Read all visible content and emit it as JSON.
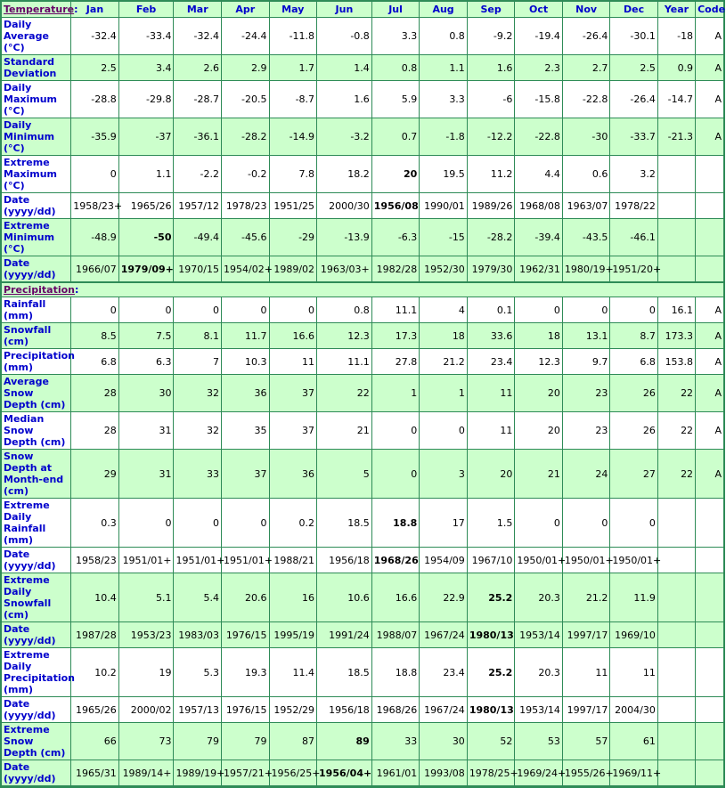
{
  "header": {
    "section1": "Temperature",
    "section2": "Precipitation",
    "colon": ":",
    "months": [
      "Jan",
      "Feb",
      "Mar",
      "Apr",
      "May",
      "Jun",
      "Jul",
      "Aug",
      "Sep",
      "Oct",
      "Nov",
      "Dec"
    ],
    "year": "Year",
    "code": "Code"
  },
  "colors": {
    "border": "#2e8b57",
    "green_row": "#ccffcc",
    "label_text": "#0000cc",
    "section_link": "#660066"
  },
  "temperature": [
    {
      "label": "Daily Average (°C)",
      "bg": "w",
      "values": [
        "-32.4",
        "-33.4",
        "-32.4",
        "-24.4",
        "-11.8",
        "-0.8",
        "3.3",
        "0.8",
        "-9.2",
        "-19.4",
        "-26.4",
        "-30.1"
      ],
      "year": "-18",
      "code": "A",
      "bold": []
    },
    {
      "label": "Standard Deviation",
      "bg": "g",
      "values": [
        "2.5",
        "3.4",
        "2.6",
        "2.9",
        "1.7",
        "1.4",
        "0.8",
        "1.1",
        "1.6",
        "2.3",
        "2.7",
        "2.5"
      ],
      "year": "0.9",
      "code": "A",
      "bold": []
    },
    {
      "label": "Daily Maximum (°C)",
      "bg": "w",
      "values": [
        "-28.8",
        "-29.8",
        "-28.7",
        "-20.5",
        "-8.7",
        "1.6",
        "5.9",
        "3.3",
        "-6",
        "-15.8",
        "-22.8",
        "-26.4"
      ],
      "year": "-14.7",
      "code": "A",
      "bold": []
    },
    {
      "label": "Daily Minimum (°C)",
      "bg": "g",
      "values": [
        "-35.9",
        "-37",
        "-36.1",
        "-28.2",
        "-14.9",
        "-3.2",
        "0.7",
        "-1.8",
        "-12.2",
        "-22.8",
        "-30",
        "-33.7"
      ],
      "year": "-21.3",
      "code": "A",
      "bold": []
    },
    {
      "label": "Extreme Maximum (°C)",
      "bg": "w",
      "values": [
        "0",
        "1.1",
        "-2.2",
        "-0.2",
        "7.8",
        "18.2",
        "20",
        "19.5",
        "11.2",
        "4.4",
        "0.6",
        "3.2"
      ],
      "year": "",
      "code": "",
      "bold": [
        6
      ]
    },
    {
      "label": "Date (yyyy/dd)",
      "bg": "w",
      "values": [
        "1958/23+",
        "1965/26",
        "1957/12",
        "1978/23",
        "1951/25",
        "2000/30",
        "1956/08",
        "1990/01",
        "1989/26",
        "1968/08",
        "1963/07",
        "1978/22"
      ],
      "year": "",
      "code": "",
      "bold": [
        6
      ]
    },
    {
      "label": "Extreme Minimum (°C)",
      "bg": "g",
      "values": [
        "-48.9",
        "-50",
        "-49.4",
        "-45.6",
        "-29",
        "-13.9",
        "-6.3",
        "-15",
        "-28.2",
        "-39.4",
        "-43.5",
        "-46.1"
      ],
      "year": "",
      "code": "",
      "bold": [
        1
      ]
    },
    {
      "label": "Date (yyyy/dd)",
      "bg": "g",
      "values": [
        "1966/07",
        "1979/09+",
        "1970/15",
        "1954/02+",
        "1989/02",
        "1963/03+",
        "1982/28",
        "1952/30",
        "1979/30",
        "1962/31",
        "1980/19+",
        "1951/20+"
      ],
      "year": "",
      "code": "",
      "bold": [
        1
      ]
    }
  ],
  "precipitation": [
    {
      "label": "Rainfall (mm)",
      "bg": "w",
      "values": [
        "0",
        "0",
        "0",
        "0",
        "0",
        "0.8",
        "11.1",
        "4",
        "0.1",
        "0",
        "0",
        "0"
      ],
      "year": "16.1",
      "code": "A",
      "bold": []
    },
    {
      "label": "Snowfall (cm)",
      "bg": "g",
      "values": [
        "8.5",
        "7.5",
        "8.1",
        "11.7",
        "16.6",
        "12.3",
        "17.3",
        "18",
        "33.6",
        "18",
        "13.1",
        "8.7"
      ],
      "year": "173.3",
      "code": "A",
      "bold": []
    },
    {
      "label": "Precipitation (mm)",
      "bg": "w",
      "values": [
        "6.8",
        "6.3",
        "7",
        "10.3",
        "11",
        "11.1",
        "27.8",
        "21.2",
        "23.4",
        "12.3",
        "9.7",
        "6.8"
      ],
      "year": "153.8",
      "code": "A",
      "bold": []
    },
    {
      "label": "Average Snow Depth (cm)",
      "bg": "g",
      "values": [
        "28",
        "30",
        "32",
        "36",
        "37",
        "22",
        "1",
        "1",
        "11",
        "20",
        "23",
        "26"
      ],
      "year": "22",
      "code": "A",
      "bold": []
    },
    {
      "label": "Median Snow Depth (cm)",
      "bg": "w",
      "values": [
        "28",
        "31",
        "32",
        "35",
        "37",
        "21",
        "0",
        "0",
        "11",
        "20",
        "23",
        "26"
      ],
      "year": "22",
      "code": "A",
      "bold": []
    },
    {
      "label": "Snow Depth at Month-end (cm)",
      "bg": "g",
      "values": [
        "29",
        "31",
        "33",
        "37",
        "36",
        "5",
        "0",
        "3",
        "20",
        "21",
        "24",
        "27"
      ],
      "year": "22",
      "code": "A",
      "bold": []
    },
    {
      "label": "Extreme Daily Rainfall (mm)",
      "bg": "w",
      "values": [
        "0.3",
        "0",
        "0",
        "0",
        "0.2",
        "18.5",
        "18.8",
        "17",
        "1.5",
        "0",
        "0",
        "0"
      ],
      "year": "",
      "code": "",
      "bold": [
        6
      ]
    },
    {
      "label": "Date (yyyy/dd)",
      "bg": "w",
      "values": [
        "1958/23",
        "1951/01+",
        "1951/01+",
        "1951/01+",
        "1988/21",
        "1956/18",
        "1968/26",
        "1954/09",
        "1967/10",
        "1950/01+",
        "1950/01+",
        "1950/01+"
      ],
      "year": "",
      "code": "",
      "bold": [
        6
      ]
    },
    {
      "label": "Extreme Daily Snowfall (cm)",
      "bg": "g",
      "values": [
        "10.4",
        "5.1",
        "5.4",
        "20.6",
        "16",
        "10.6",
        "16.6",
        "22.9",
        "25.2",
        "20.3",
        "21.2",
        "11.9"
      ],
      "year": "",
      "code": "",
      "bold": [
        8
      ]
    },
    {
      "label": "Date (yyyy/dd)",
      "bg": "g",
      "values": [
        "1987/28",
        "1953/23",
        "1983/03",
        "1976/15",
        "1995/19",
        "1991/24",
        "1988/07",
        "1967/24",
        "1980/13",
        "1953/14",
        "1997/17",
        "1969/10"
      ],
      "year": "",
      "code": "",
      "bold": [
        8
      ]
    },
    {
      "label": "Extreme Daily Precipitation (mm)",
      "bg": "w",
      "values": [
        "10.2",
        "19",
        "5.3",
        "19.3",
        "11.4",
        "18.5",
        "18.8",
        "23.4",
        "25.2",
        "20.3",
        "11",
        "11"
      ],
      "year": "",
      "code": "",
      "bold": [
        8
      ]
    },
    {
      "label": "Date (yyyy/dd)",
      "bg": "w",
      "values": [
        "1965/26",
        "2000/02",
        "1957/13",
        "1976/15",
        "1952/29",
        "1956/18",
        "1968/26",
        "1967/24",
        "1980/13",
        "1953/14",
        "1997/17",
        "2004/30"
      ],
      "year": "",
      "code": "",
      "bold": [
        8
      ]
    },
    {
      "label": "Extreme Snow Depth (cm)",
      "bg": "g",
      "values": [
        "66",
        "73",
        "79",
        "79",
        "87",
        "89",
        "33",
        "30",
        "52",
        "53",
        "57",
        "61"
      ],
      "year": "",
      "code": "",
      "bold": [
        5
      ]
    },
    {
      "label": "Date (yyyy/dd)",
      "bg": "g",
      "values": [
        "1965/31",
        "1989/14+",
        "1989/19+",
        "1957/21+",
        "1956/25+",
        "1956/04+",
        "1961/01",
        "1993/08",
        "1978/25+",
        "1969/24+",
        "1955/26+",
        "1969/11+"
      ],
      "year": "",
      "code": "",
      "bold": [
        5
      ]
    }
  ]
}
